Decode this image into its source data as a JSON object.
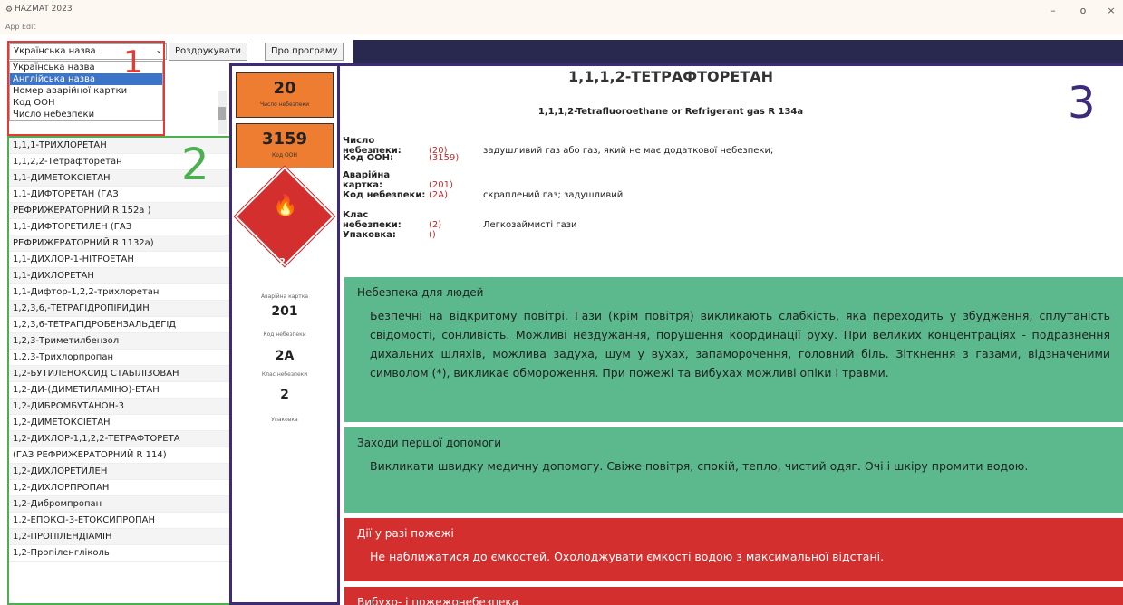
{
  "window": {
    "title": "HAZMAT 2023",
    "menu": [
      "App",
      "Edit"
    ],
    "controls": [
      "–",
      "o",
      "×"
    ]
  },
  "toolbar": {
    "select_value": "Українська назва",
    "print_label": "Роздрукувати",
    "about_label": "Про програму"
  },
  "dropdown_options": [
    "Українська назва",
    "Англійська назва",
    "Номер аварійної картки",
    "Код ООН",
    "Число небезпеки"
  ],
  "annotations": [
    "1",
    "2",
    "3"
  ],
  "substance_list": [
    "1,1,1-ТРИХЛОРЕТАН",
    "1,1,2,2-Тетрафторетан",
    "1,1-ДИМЕТОКСІЕТАН",
    "1,1-ДИФТОРЕТАН (ГАЗ",
    "РЕФРИЖЕРАТОРНИЙ R 152a )",
    "1,1-ДИФТОРЕТИЛЕН (ГАЗ",
    "РЕФРИЖЕРАТОРНИЙ R 1132a)",
    "1,1-ДИХЛОР-1-НІТРОЕТАН",
    "1,1-ДИХЛОРЕТАН",
    "1,1-Дифтор-1,2,2-трихлоретан",
    "1,2,3,6,-ТЕТРАГІДРОПІРИДИН",
    "1,2,3,6-ТЕТРАГІДРОБЕНЗАЛЬДЕГІД",
    "1,2,3-Триметилбензол",
    "1,2,3-Трихлорпропан",
    "1,2-БУТИЛЕНОКСИД СТАБІЛІЗОВАН",
    "1,2-ДИ-(ДИМЕТИЛАМІНО)-ЕТАН",
    "1,2-ДИБРОМБУТАНОН-3",
    "1,2-ДИМЕТОКСІЕТАН",
    "1,2-ДИХЛОР-1,1,2,2-ТЕТРАФТОРЕТА",
    "(ГАЗ РЕФРИЖЕРАТОРНИЙ R 114)",
    "1,2-ДИХЛОРЕТИЛЕН",
    "1,2-ДИХЛОРПРОПАН",
    "1,2-Дибромпропан",
    "1,2-ЕПОКСІ-3-ЕТОКСИПРОПАН",
    "1,2-ПРОПІЛЕНДІАМІН",
    "1,2-Пропіленгліколь"
  ],
  "middle": {
    "hazard_number": "20",
    "hazard_number_label": "Число небезпеки",
    "un_code": "3159",
    "un_code_label": "Код ООН",
    "diamond_class": "2",
    "card_label": "Аварійна картка",
    "card_value": "201",
    "hazard_code_label": "Код небезпеки",
    "hazard_code_value": "2A",
    "class_label": "Клас небезпеки",
    "class_value": "2",
    "pack_label": "Упаковка"
  },
  "detail": {
    "title": "1,1,1,2-ТЕТРАФТОРЕТАН",
    "subtitle": "1,1,1,2-Tetrafluoroethane or Refrigerant gas R 134a",
    "rows": [
      {
        "label": "Число небезпеки:",
        "value": "(20)",
        "desc": "задушливий газ або газ, який не має додаткової небезпеки;"
      },
      {
        "label": "Код ООН:",
        "value": "(3159)",
        "desc": ""
      },
      {
        "label": "Аварійна картка:",
        "value": "(201)",
        "desc": ""
      },
      {
        "label": "Код небезпеки:",
        "value": "(2A)",
        "desc": "скраплений газ; задушливий"
      },
      {
        "label": "Клас небезпеки:",
        "value": "(2)",
        "desc": "Легкозаймисті гази"
      },
      {
        "label": "Упаковка:",
        "value": "()",
        "desc": ""
      }
    ],
    "people_heading": "Небезпека для людей",
    "people_text": "Безпечні на відкритому повітрі. Гази (крім повітря) викликають слабкість, яка переходить у збудження, сплутаність свідомості, сонливість. Можливі нездужання, порушення координації руху. При великих концентраціях - подразнення дихальних шляхів, можлива задуха, шум у вухах, запаморочення, головний біль. Зіткнення з газами, відзначеними символом (*), викликає обмороження. При пожежі та вибухах можливі опіки і травми.",
    "firstaid_heading": "Заходи першої допомоги",
    "firstaid_text": "Викликати швидку медичну допомогу. Свіже повітря, спокій, тепло, чистий одяг. Очі і шкіру промити водою.",
    "fire_heading": "Дії у разі пожежі",
    "fire_text": "Не наближатися до ємкостей. Охолоджувати ємкості водою з максимальної відстані.",
    "explosion_heading": "Вибухо- і пожежонебезпека"
  },
  "colors": {
    "orange": "#ee7d31",
    "green": "#5cb98e",
    "red": "#d32f2f",
    "navy": "#292950"
  }
}
